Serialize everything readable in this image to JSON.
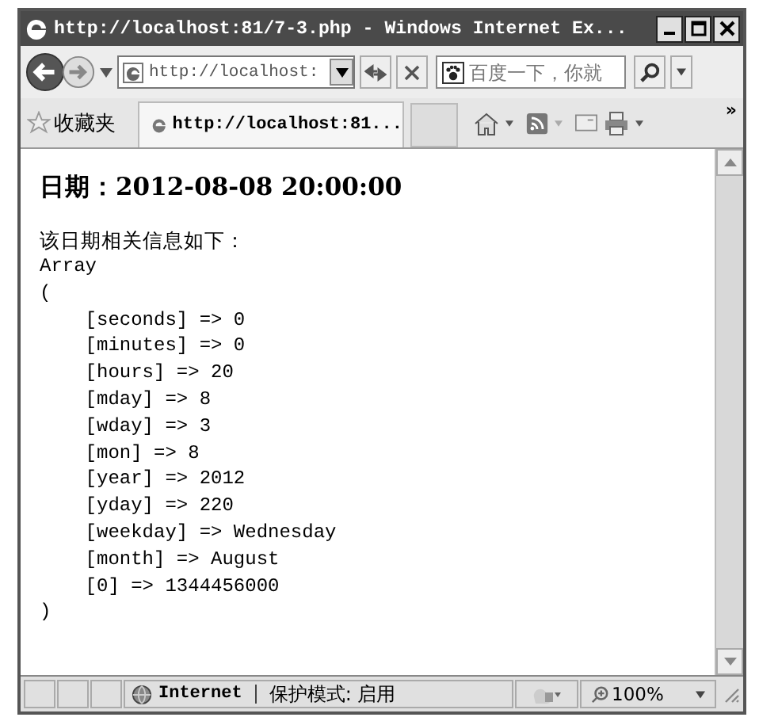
{
  "window": {
    "title": "http://localhost:81/7-3.php - Windows Internet Ex..."
  },
  "address_bar": {
    "value": "http://localhost:"
  },
  "search": {
    "placeholder": "百度一下，你就"
  },
  "favorites_bar": {
    "label": "收藏夹",
    "tab": "http://localhost:81...",
    "overflow": "»"
  },
  "page": {
    "heading": "日期：2012-08-08 20:00:00",
    "intro": "该日期相关信息如下：",
    "lines": [
      "Array",
      "(",
      "    [seconds] => 0",
      "    [minutes] => 0",
      "    [hours] => 20",
      "    [mday] => 8",
      "    [wday] => 3",
      "    [mon] => 8",
      "    [year] => 2012",
      "    [yday] => 220",
      "    [weekday] => Wednesday",
      "    [month] => August",
      "    [0] => 1344456000",
      ")"
    ]
  },
  "status_bar": {
    "zone": "Internet",
    "protected_mode": "保护模式: 启用",
    "zoom": "100%"
  }
}
